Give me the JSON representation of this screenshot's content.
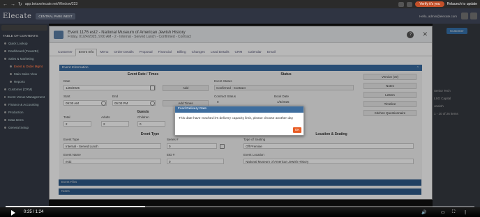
{
  "browser": {
    "url": "app.betaxelecate.net/Window/223",
    "verify_pill": "Verify it's you",
    "relaunch": "Relaunch to update"
  },
  "app": {
    "logo": "Elecate",
    "venue": "CENTRAL PARK WEST",
    "hello": "Hello, admin@elecate.com"
  },
  "sidebar": {
    "title": "TABLE OF CONTENTS",
    "items": [
      {
        "label": "Quick Lookup",
        "sub": false,
        "active": false
      },
      {
        "label": "Dashboard (PowerBI)",
        "sub": false,
        "active": false
      },
      {
        "label": "Sales & Marketing",
        "sub": false,
        "active": false
      },
      {
        "label": "Event & Order Mgmt",
        "sub": true,
        "active": true
      },
      {
        "label": "Main Sales View",
        "sub": true,
        "active": false
      },
      {
        "label": "Reports",
        "sub": true,
        "active": false
      },
      {
        "label": "Customer (CRM)",
        "sub": false,
        "active": false
      },
      {
        "label": "Event Venue Management",
        "sub": false,
        "active": false
      },
      {
        "label": "Finance & Accounting",
        "sub": false,
        "active": false
      },
      {
        "label": "Production",
        "sub": false,
        "active": false
      },
      {
        "label": "Data Items",
        "sub": false,
        "active": false
      },
      {
        "label": "General Setup",
        "sub": false,
        "active": false
      }
    ]
  },
  "right_panel": {
    "button": "Customer",
    "items": [
      "Senior Tech",
      "LSG Capital",
      "Jewish",
      "1 - 10 of 26 items"
    ]
  },
  "modal": {
    "title_line1": "Event 1176 est2 - National Museum of American Jewish History",
    "title_line2": "Friday, 01/24/2025, 9:00 AM - 2 - Internal - Served Lunch - Confirmed - Contract",
    "tabs": [
      "Customer",
      "Event Info",
      "Menu",
      "Order Details",
      "Proposal",
      "Financial",
      "Billing",
      "Changes",
      "Lead Details",
      "CRM",
      "Calendar",
      "Email"
    ],
    "active_tab": "Event Info",
    "section_event_info": "Event Information",
    "date_times": {
      "heading": "Event Date / Times",
      "date_label": "Date",
      "date_value": "1/28/2025",
      "add_button": "Add",
      "start_label": "Start",
      "start_value": "09:00 AM",
      "end_label": "End",
      "end_value": "05:00 PM",
      "add_times_button": "Add Times"
    },
    "status": {
      "heading": "Status",
      "event_status_label": "Event Status",
      "event_status_value": "Confirmed - Contract",
      "contract_status_label": "Contract Status",
      "contract_status_value": "0",
      "book_date_label": "Book Date",
      "book_date_value": "1/5/2025"
    },
    "actions": [
      "Version (v0)",
      "Notes",
      "Letters",
      "Timeline",
      "Kitchen Questionnaire"
    ],
    "guests": {
      "heading": "Guests",
      "total_label": "Total",
      "total_value": "2",
      "adults_label": "Adults",
      "adults_value": "2",
      "children_label": "Children",
      "children_value": "0"
    },
    "event_type": {
      "heading": "Event Type",
      "type_label": "Event Type",
      "type_value": "Internal - Served Lunch",
      "series_label": "Series #",
      "series_value": "0",
      "name_label": "Event Name",
      "name_value": "est2",
      "eid_label": "EID #",
      "eid_value": "0"
    },
    "location": {
      "heading": "Location & Seating",
      "seating_label": "Type of Seating",
      "seating_value": "Off Premise",
      "location_label": "Event Location",
      "location_value": "National Museum of American Jewish History"
    },
    "bottom_sections": [
      "Event Files",
      "Notes"
    ]
  },
  "dialog": {
    "title": "Food Delivery Date",
    "message": "This date have reached it's delivery capacity limit, please choose another day",
    "ok": "OK"
  },
  "player": {
    "time": "0:25 / 1:24",
    "progress": 0.298
  }
}
